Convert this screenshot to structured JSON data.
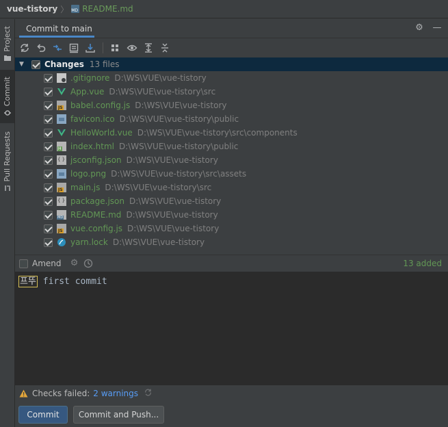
{
  "breadcrumb": {
    "project": "vue-tistory",
    "file": "README.md"
  },
  "sidebar": {
    "tabs": [
      {
        "label": "Project"
      },
      {
        "label": "Commit"
      },
      {
        "label": "Pull Requests"
      }
    ]
  },
  "panel": {
    "tab_title": "Commit to main"
  },
  "toolbar": {
    "icons": [
      "refresh-icon",
      "rollback-icon",
      "diff-icon",
      "shelve-icon",
      "download-icon",
      "group-by-icon",
      "view-options-icon",
      "expand-all-icon",
      "collapse-all-icon"
    ]
  },
  "changes": {
    "label": "Changes",
    "count": "13 files",
    "files": [
      {
        "name": ".gitignore",
        "path": "D:\\WS\\VUE\\vue-tistory",
        "icon": "gitignore-file-icon"
      },
      {
        "name": "App.vue",
        "path": "D:\\WS\\VUE\\vue-tistory\\src",
        "icon": "vue-file-icon"
      },
      {
        "name": "babel.config.js",
        "path": "D:\\WS\\VUE\\vue-tistory",
        "icon": "js-file-icon"
      },
      {
        "name": "favicon.ico",
        "path": "D:\\WS\\VUE\\vue-tistory\\public",
        "icon": "ico-file-icon"
      },
      {
        "name": "HelloWorld.vue",
        "path": "D:\\WS\\VUE\\vue-tistory\\src\\components",
        "icon": "vue-file-icon"
      },
      {
        "name": "index.html",
        "path": "D:\\WS\\VUE\\vue-tistory\\public",
        "icon": "html-file-icon"
      },
      {
        "name": "jsconfig.json",
        "path": "D:\\WS\\VUE\\vue-tistory",
        "icon": "json-file-icon"
      },
      {
        "name": "logo.png",
        "path": "D:\\WS\\VUE\\vue-tistory\\src\\assets",
        "icon": "image-file-icon"
      },
      {
        "name": "main.js",
        "path": "D:\\WS\\VUE\\vue-tistory\\src",
        "icon": "js-file-icon"
      },
      {
        "name": "package.json",
        "path": "D:\\WS\\VUE\\vue-tistory",
        "icon": "json-file-icon"
      },
      {
        "name": "README.md",
        "path": "D:\\WS\\VUE\\vue-tistory",
        "icon": "md-file-icon"
      },
      {
        "name": "vue.config.js",
        "path": "D:\\WS\\VUE\\vue-tistory",
        "icon": "js-file-icon"
      },
      {
        "name": "yarn.lock",
        "path": "D:\\WS\\VUE\\vue-tistory",
        "icon": "yarn-file-icon"
      }
    ]
  },
  "amend": {
    "label": "Amend",
    "added": "13 added"
  },
  "commit_message": {
    "prefix": "프뚜",
    "text": " first commit"
  },
  "checks": {
    "label": "Checks failed:",
    "warnings": "2 warnings"
  },
  "buttons": {
    "commit": "Commit",
    "commit_push": "Commit and Push..."
  },
  "colors": {
    "accent": "#4a88c7",
    "added": "#629755",
    "link": "#589df6",
    "primary_button": "#365880",
    "vue": "#41b883",
    "warning": "#e2a53a"
  }
}
